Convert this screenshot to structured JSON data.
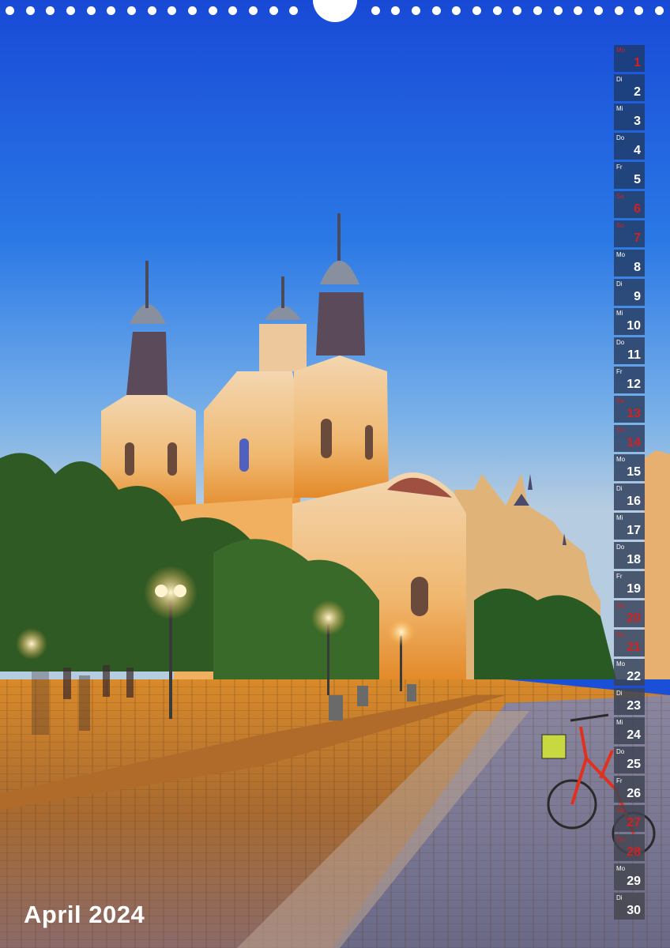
{
  "calendar": {
    "month_title": "April 2024",
    "weekend_color": "#d42020",
    "days": [
      {
        "wd": "Mo",
        "num": "1",
        "weekend": true
      },
      {
        "wd": "Di",
        "num": "2",
        "weekend": false
      },
      {
        "wd": "Mi",
        "num": "3",
        "weekend": false
      },
      {
        "wd": "Do",
        "num": "4",
        "weekend": false
      },
      {
        "wd": "Fr",
        "num": "5",
        "weekend": false
      },
      {
        "wd": "Sa",
        "num": "6",
        "weekend": true
      },
      {
        "wd": "So",
        "num": "7",
        "weekend": true
      },
      {
        "wd": "Mo",
        "num": "8",
        "weekend": false
      },
      {
        "wd": "Di",
        "num": "9",
        "weekend": false
      },
      {
        "wd": "Mi",
        "num": "10",
        "weekend": false
      },
      {
        "wd": "Do",
        "num": "11",
        "weekend": false
      },
      {
        "wd": "Fr",
        "num": "12",
        "weekend": false
      },
      {
        "wd": "Sa",
        "num": "13",
        "weekend": true
      },
      {
        "wd": "So",
        "num": "14",
        "weekend": true
      },
      {
        "wd": "Mo",
        "num": "15",
        "weekend": false
      },
      {
        "wd": "Di",
        "num": "16",
        "weekend": false
      },
      {
        "wd": "Mi",
        "num": "17",
        "weekend": false
      },
      {
        "wd": "Do",
        "num": "18",
        "weekend": false
      },
      {
        "wd": "Fr",
        "num": "19",
        "weekend": false
      },
      {
        "wd": "Sa",
        "num": "20",
        "weekend": true
      },
      {
        "wd": "So",
        "num": "21",
        "weekend": true
      },
      {
        "wd": "Mo",
        "num": "22",
        "weekend": false
      },
      {
        "wd": "Di",
        "num": "23",
        "weekend": false
      },
      {
        "wd": "Mi",
        "num": "24",
        "weekend": false
      },
      {
        "wd": "Do",
        "num": "25",
        "weekend": false
      },
      {
        "wd": "Fr",
        "num": "26",
        "weekend": false
      },
      {
        "wd": "Sa",
        "num": "27",
        "weekend": true
      },
      {
        "wd": "So",
        "num": "28",
        "weekend": true
      },
      {
        "wd": "Mo",
        "num": "29",
        "weekend": false
      },
      {
        "wd": "Di",
        "num": "30",
        "weekend": false
      }
    ]
  }
}
